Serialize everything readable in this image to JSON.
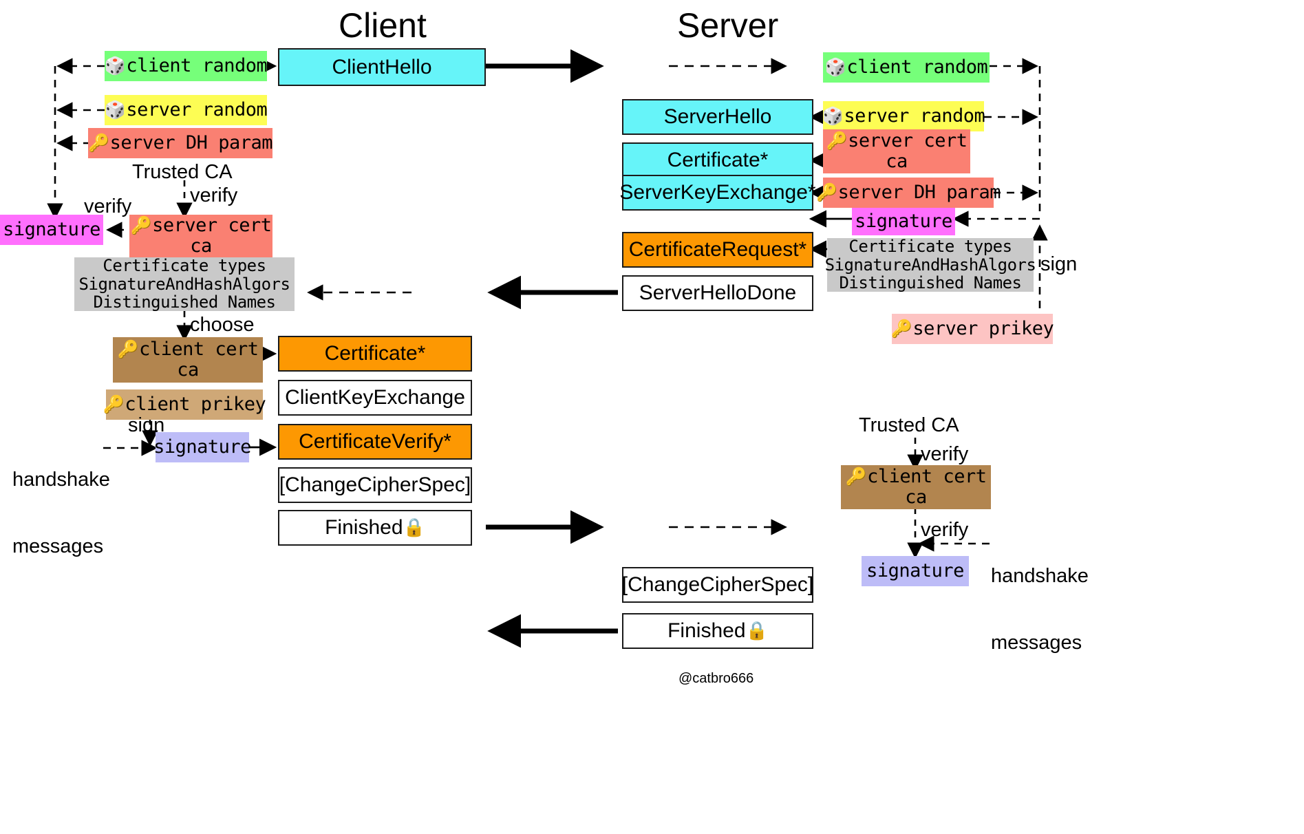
{
  "headers": {
    "client": "Client",
    "server": "Server"
  },
  "watermark": "@catbro666",
  "icons": {
    "dice": "🎲",
    "key": "🔑",
    "lock": "🔒"
  },
  "colors": {
    "cyan_message": "#66f4f9",
    "orange_message": "#fd9802",
    "white_message": "#ffffff",
    "green_chip": "#76ff7a",
    "yellow_chip": "#fdfd54",
    "red_chip": "#fa8072",
    "magenta_chip": "#ff6ffd",
    "gray_chip": "#c9c9c9",
    "brown_chip": "#b2854f",
    "light_brown_chip": "#cfa877",
    "periwinkle_chip": "#bdbcf7",
    "pink_chip": "#fdc4c3",
    "outline": "#1a1a1a"
  },
  "client_side": {
    "chips": {
      "client_random": "client random",
      "server_random": "server random",
      "server_dh_param": "server DH param",
      "signature": "signature",
      "server_cert_line1": "server cert",
      "server_cert_line2": "ca",
      "cert_req_line1": "Certificate types",
      "cert_req_line2": "SignatureAndHashAlgors",
      "cert_req_line3": "Distinguished Names",
      "client_cert_line1": "client cert",
      "client_cert_line2": "ca",
      "client_prikey": "client prikey",
      "client_signature": "signature"
    },
    "labels": {
      "trusted_ca": "Trusted CA",
      "verify_down": "verify",
      "verify_left": "verify",
      "choose": "choose",
      "sign": "sign",
      "handshake_line1": "handshake",
      "handshake_line2": "messages"
    },
    "messages": [
      "ClientHello",
      "Certificate*",
      "ClientKeyExchange",
      "CertificateVerify*",
      "[ChangeCipherSpec]",
      "Finished"
    ]
  },
  "server_side": {
    "messages": [
      "ServerHello",
      "Certificate*",
      "ServerKeyExchange*",
      "CertificateRequest*",
      "ServerHelloDone",
      "[ChangeCipherSpec]",
      "Finished"
    ],
    "chips": {
      "client_random": "client random",
      "server_random": "server random",
      "server_cert_line1": "server cert",
      "server_cert_line2": "ca",
      "server_dh_param": "server DH param",
      "signature": "signature",
      "cert_req_line1": "Certificate types",
      "cert_req_line2": "SignatureAndHashAlgors",
      "cert_req_line3": "Distinguished Names",
      "server_prikey": "server prikey",
      "client_cert_line1": "client cert",
      "client_cert_line2": "ca",
      "client_signature": "signature"
    },
    "labels": {
      "sign": "sign",
      "trusted_ca": "Trusted CA",
      "verify_top": "verify",
      "verify_bottom": "verify",
      "handshake_line1": "handshake",
      "handshake_line2": "messages"
    }
  }
}
